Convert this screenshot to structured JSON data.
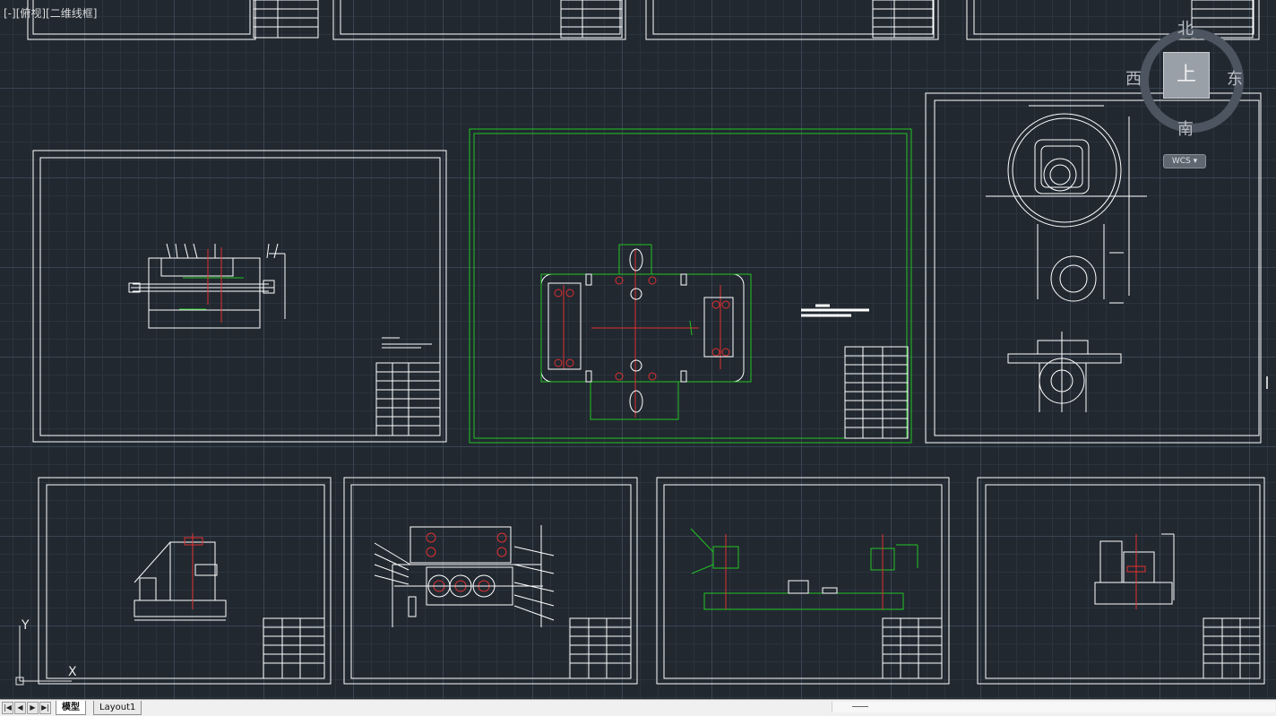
{
  "viewport": {
    "label": "[-][俯视][二维线框]"
  },
  "viewcube": {
    "north": "北",
    "south": "南",
    "east": "东",
    "west": "西",
    "top_face": "上",
    "wcs": "WCS",
    "wcs_arrow": "▾"
  },
  "ucs": {
    "x_label": "X",
    "y_label": "Y"
  },
  "tabs": {
    "model": "模型",
    "layout1": "Layout1"
  },
  "nav": {
    "first": "|◀",
    "prev": "◀",
    "next": "▶",
    "last": "▶|"
  },
  "colors": {
    "background": "#212830",
    "lines": "#ffffff",
    "selected": "#22c322",
    "centerline": "#e03030",
    "cyan": "#00c8c8",
    "tab_bar": "#f0f0f0"
  }
}
